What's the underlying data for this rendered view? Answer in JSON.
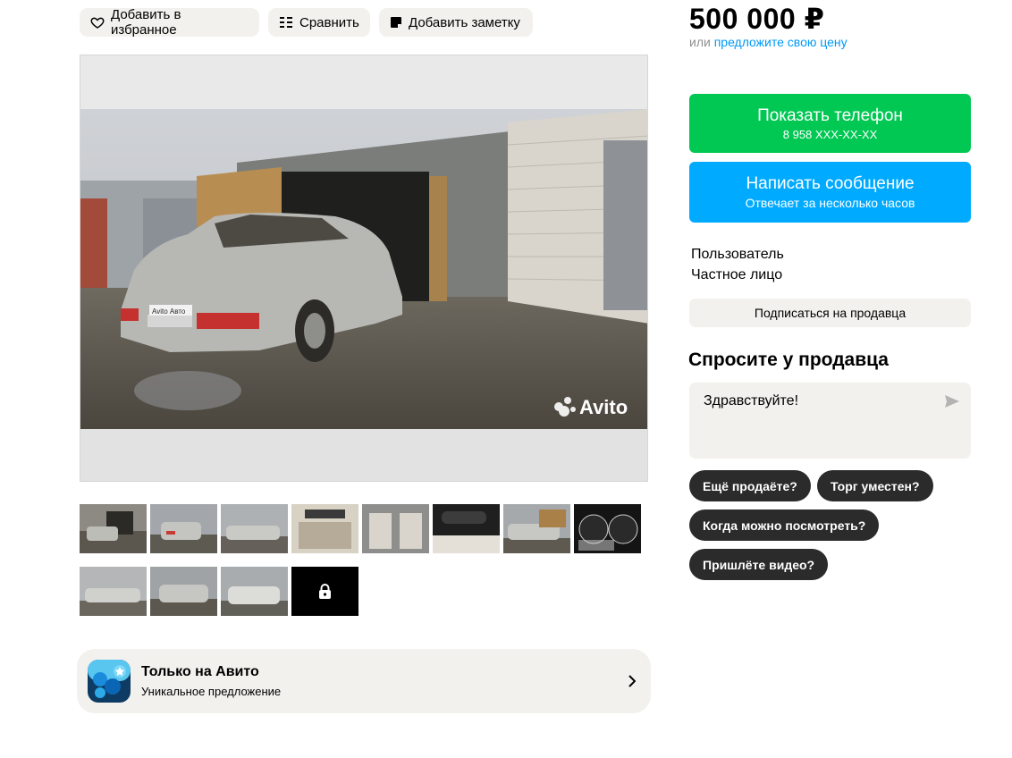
{
  "actions": {
    "favorite_label": "Добавить в избранное",
    "compare_label": "Сравнить",
    "note_label": "Добавить заметку"
  },
  "gallery": {
    "watermark": "Avito",
    "plate_text": "Avito Авто",
    "thumbnail_count": 12,
    "active_index": 0,
    "locked_icon": "lock-icon"
  },
  "price": {
    "value": "500 000 ₽",
    "or_text": "или",
    "offer_link": "предложите свою цену"
  },
  "phone_button": {
    "label": "Показать телефон",
    "number": "8 958 XXX-XX-XX",
    "color": "#00c853"
  },
  "message_button": {
    "label": "Написать сообщение",
    "subtitle": "Отвечает за несколько часов",
    "color": "#00aaff"
  },
  "seller": {
    "name": "Пользователь",
    "type": "Частное лицо",
    "subscribe_label": "Подписаться на продавца"
  },
  "ask": {
    "title": "Спросите у продавца",
    "message_value": "Здравствуйте!",
    "quick_replies": [
      "Ещё продаёте?",
      "Торг уместен?",
      "Когда можно посмотреть?",
      "Пришлёте видео?"
    ]
  },
  "promo": {
    "title": "Только на Авито",
    "subtitle": "Уникальное предложение"
  }
}
